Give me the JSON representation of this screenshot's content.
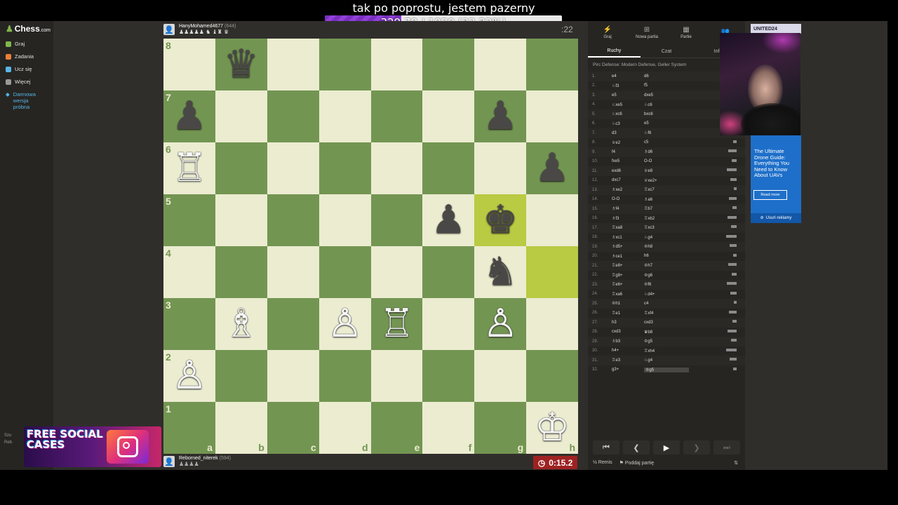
{
  "stream": {
    "title": "tak po poprostu, jestem pazerny",
    "progress_text": "329.70 / 1020 (32.32%)",
    "progress_fraction": 0.3232
  },
  "sidebar": {
    "logo": "Chess",
    "logo_suffix": ".com",
    "items": [
      {
        "label": "Graj",
        "icon": "pawn-icon",
        "color": "#81b64c"
      },
      {
        "label": "Zadania",
        "icon": "puzzle-icon",
        "color": "#e8803a"
      },
      {
        "label": "Ucz się",
        "icon": "learn-icon",
        "color": "#59b5e6"
      },
      {
        "label": "Więcej",
        "icon": "more-icon",
        "color": "#999999"
      }
    ],
    "promo": "Darmowa wersja próbna",
    "bottom": [
      "Szu",
      "Reb"
    ]
  },
  "opponent": {
    "name": "HanyMohamed4677",
    "rating": "(644)",
    "captured": "♟♟♟♟♟ ♞ ♝♜ ♛",
    "clock": ":22"
  },
  "player": {
    "name": "Reborned_niterek",
    "rating": "(594)",
    "captured": "♟♟♟♟",
    "clock": "0:15.2"
  },
  "board": {
    "ranks": [
      "8",
      "7",
      "6",
      "5",
      "4",
      "3",
      "2",
      "1"
    ],
    "files": [
      "a",
      "b",
      "c",
      "d",
      "e",
      "f",
      "g",
      "h"
    ],
    "highlight": [
      "g5",
      "h4"
    ],
    "pieces": {
      "b8": "♛",
      "a7": "♟",
      "g7": "♟",
      "a6": "♖",
      "h6": "♟",
      "f5": "♟",
      "g5": "♚",
      "g4": "♞",
      "b3": "♗",
      "d3": "♙",
      "e3": "♖",
      "g3": "♙",
      "a2": "♙",
      "h1": "♔"
    },
    "colors": {
      "b8": "b",
      "a7": "b",
      "g7": "b",
      "a6": "w",
      "h6": "b",
      "f5": "b",
      "g5": "b",
      "g4": "b",
      "b3": "w",
      "d3": "w",
      "e3": "w",
      "g3": "w",
      "a2": "w",
      "h1": "w"
    }
  },
  "panel": {
    "tabs": [
      {
        "label": "Graj",
        "icon": "bolt-icon"
      },
      {
        "label": "Nowa partia",
        "icon": "plus-icon"
      },
      {
        "label": "Partie",
        "icon": "grid-icon"
      },
      {
        "label": "",
        "icon": "users-icon"
      }
    ],
    "subtabs": [
      "Ruchy",
      "Czat",
      "Infor"
    ],
    "opening": "Pirc Defense: Modern Defense, Geller System",
    "moves": [
      [
        "1.",
        "e4",
        "d6"
      ],
      [
        "2.",
        "♘f3",
        "f5"
      ],
      [
        "3.",
        "e5",
        "dxe5"
      ],
      [
        "4.",
        "♘xe5",
        "♘c6"
      ],
      [
        "5.",
        "♘xc6",
        "bxc6"
      ],
      [
        "6.",
        "♘c3",
        "e5"
      ],
      [
        "7.",
        "d3",
        "♘f6"
      ],
      [
        "8.",
        "♕e2",
        "c5"
      ],
      [
        "9.",
        "f4",
        "♗d6"
      ],
      [
        "10.",
        "fxe5",
        "O-O"
      ],
      [
        "11.",
        "exd6",
        "♕e8"
      ],
      [
        "12.",
        "dxc7",
        "♕xe2+"
      ],
      [
        "13.",
        "♗xe2",
        "♖xc7"
      ],
      [
        "14.",
        "O-O",
        "♗a6"
      ],
      [
        "15.",
        "♗f4",
        "♖b7"
      ],
      [
        "16.",
        "♗f3",
        "♖xb2"
      ],
      [
        "17.",
        "♖xa8",
        "♖xc3"
      ],
      [
        "18.",
        "♗xc1",
        "♘g4"
      ],
      [
        "19.",
        "♗d5+",
        "♔h8"
      ],
      [
        "20.",
        "♗ce1",
        "h6"
      ],
      [
        "21.",
        "♖e8+",
        "♔h7"
      ],
      [
        "22.",
        "♖g8+",
        "♔g6"
      ],
      [
        "23.",
        "♖e6+",
        "♔f6"
      ],
      [
        "24.",
        "♖xa6",
        "♘d4+"
      ],
      [
        "25.",
        "♔h1",
        "c4"
      ],
      [
        "26.",
        "♖e1",
        "♖xf4"
      ],
      [
        "27.",
        "h3",
        "cxd3"
      ],
      [
        "28.",
        "cxd3",
        "♛b8"
      ],
      [
        "29.",
        "♗b3",
        "♔g5"
      ],
      [
        "30.",
        "h4+",
        "♖xh4"
      ],
      [
        "31.",
        "♖e3",
        "♘g4"
      ],
      [
        "32.",
        "g3+",
        "♔g5"
      ]
    ],
    "bottom_actions": [
      "Remis",
      "Poddaj partię"
    ]
  },
  "ad": {
    "top_label": "UNITED24",
    "text": "The Ultimate Drone Guide: Everything You Need to Know About UAVs",
    "button": "Read more",
    "remove": "Usuń reklamy"
  },
  "promo_banner": {
    "text": "FREE SOCIAL CASES"
  }
}
